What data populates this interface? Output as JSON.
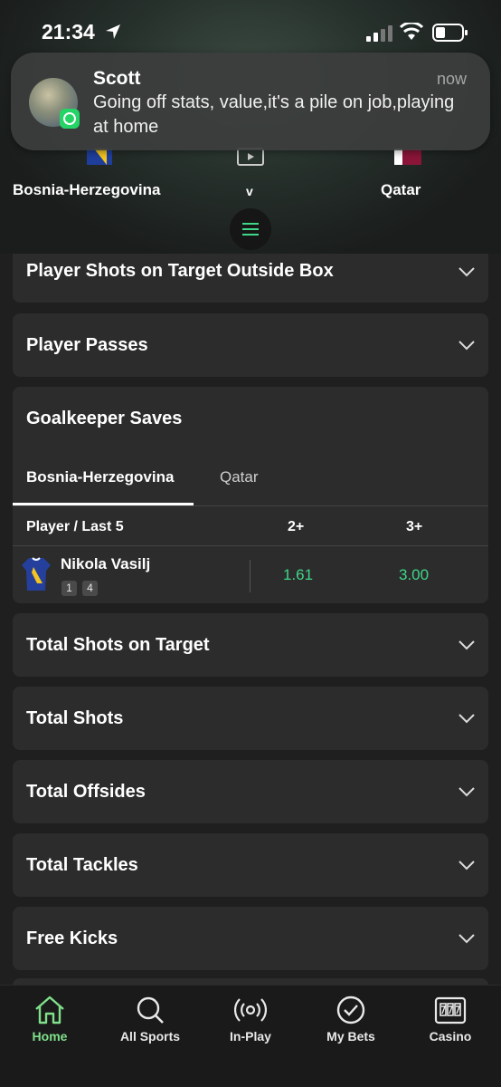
{
  "status_bar": {
    "time": "21:34"
  },
  "notification": {
    "sender": "Scott",
    "time": "now",
    "message": "Going off stats, value,it's a pile on job,playing at home"
  },
  "match": {
    "home_team": "Bosnia-Herzegovina",
    "away_team": "Qatar",
    "vs": "v"
  },
  "markets": {
    "shots_outside_box": "Player Shots on Target Outside Box",
    "passes": "Player Passes",
    "goalkeeper_saves": {
      "title": "Goalkeeper Saves",
      "tabs": [
        "Bosnia-Herzegovina",
        "Qatar"
      ],
      "columns": [
        "Player / Last 5",
        "2+",
        "3+"
      ],
      "player": {
        "name": "Nikola Vasilj",
        "form": [
          "1",
          "4"
        ],
        "odds": [
          "1.61",
          "3.00"
        ]
      }
    },
    "total_shots_on_target": "Total Shots on Target",
    "total_shots": "Total Shots",
    "total_offsides": "Total Offsides",
    "total_tackles": "Total Tackles",
    "free_kicks": "Free Kicks"
  },
  "bottom_nav": [
    "Home",
    "All Sports",
    "In-Play",
    "My Bets",
    "Casino"
  ],
  "colors": {
    "accent": "#3fd68a",
    "nav_active": "#7fe08a",
    "card": "#2c2c2c",
    "background": "#1f1f1f"
  }
}
